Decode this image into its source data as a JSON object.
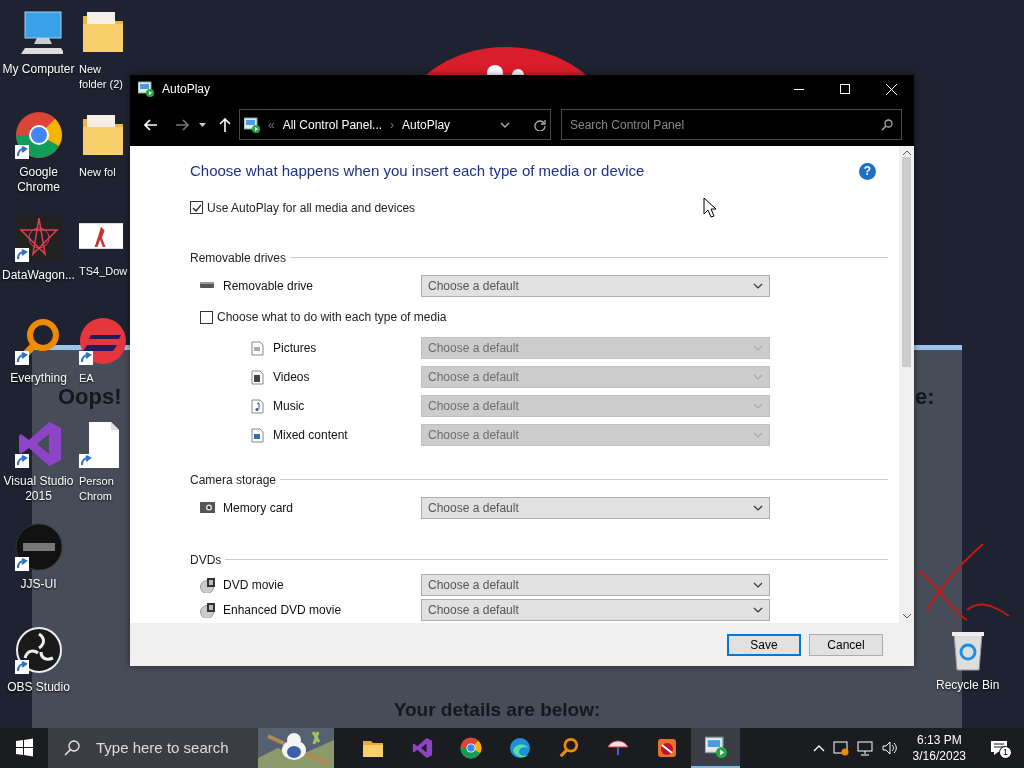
{
  "desktop_icons": [
    {
      "label": "My Computer",
      "kind": "computer",
      "shortcut": false
    },
    {
      "label": "Google Chrome",
      "kind": "chrome",
      "shortcut": true
    },
    {
      "label": "DataWagon...",
      "kind": "star",
      "shortcut": true
    },
    {
      "label": "Everything",
      "kind": "magnifier",
      "shortcut": true
    },
    {
      "label": "Visual Studio 2015",
      "kind": "ribbon",
      "shortcut": true
    },
    {
      "label": "JJS-UI",
      "kind": "darkcircle",
      "shortcut": true
    },
    {
      "label": "OBS Studio",
      "kind": "obs",
      "shortcut": true
    },
    {
      "label": "New folder (2)",
      "kind": "folder",
      "shortcut": false
    },
    {
      "label": "New fol",
      "kind": "folder",
      "shortcut": false
    },
    {
      "label": "TS4_Dow",
      "kind": "thumb",
      "shortcut": false
    },
    {
      "label": "EA",
      "kind": "redcircle",
      "shortcut": true
    },
    {
      "label": "Person Chrom",
      "kind": "document",
      "shortcut": true
    }
  ],
  "recycle_bin": {
    "label": "Recycle Bin"
  },
  "background_page": {
    "texts": [
      "Oops!",
      "e:",
      "Your details are below:"
    ]
  },
  "window": {
    "title": "AutoPlay",
    "address": {
      "overflow_mark": "«",
      "parts": [
        "All Control Panel...",
        "AutoPlay"
      ],
      "separator": "›"
    },
    "search": {
      "placeholder": "Search Control Panel"
    },
    "heading": "Choose what happens when you insert each type of media or device",
    "help": "?",
    "use_autoplay": {
      "label": "Use AutoPlay for all media and devices",
      "checked": true
    },
    "sections": [
      {
        "title": "Removable drives",
        "rows": [
          {
            "kind": "device",
            "label": "Removable drive",
            "value": "Choose a default",
            "disabled": false
          },
          {
            "kind": "checkbox",
            "label": "Choose what to do with each type of media",
            "checked": false
          },
          {
            "kind": "media",
            "label": "Pictures",
            "value": "Choose a default",
            "disabled": true
          },
          {
            "kind": "media",
            "label": "Videos",
            "value": "Choose a default",
            "disabled": true
          },
          {
            "kind": "media",
            "label": "Music",
            "value": "Choose a default",
            "disabled": true
          },
          {
            "kind": "media",
            "label": "Mixed content",
            "value": "Choose a default",
            "disabled": true
          }
        ]
      },
      {
        "title": "Camera storage",
        "rows": [
          {
            "kind": "device",
            "label": "Memory card",
            "value": "Choose a default",
            "disabled": false
          }
        ]
      },
      {
        "title": "DVDs",
        "rows": [
          {
            "kind": "device",
            "label": "DVD movie",
            "value": "Choose a default",
            "disabled": false
          },
          {
            "kind": "device",
            "label": "Enhanced DVD movie",
            "value": "Choose a default",
            "disabled": false
          }
        ]
      }
    ],
    "buttons": [
      {
        "label": "Save",
        "default": true
      },
      {
        "label": "Cancel",
        "default": false
      }
    ]
  },
  "taskbar": {
    "search": {
      "placeholder": "Type here to search"
    },
    "apps": [
      {
        "kind": "folder",
        "active": false
      },
      {
        "kind": "ribbon",
        "active": false
      },
      {
        "kind": "chrome",
        "active": false
      },
      {
        "kind": "edge",
        "active": false
      },
      {
        "kind": "magnifier",
        "active": false
      },
      {
        "kind": "umbrella",
        "active": false
      },
      {
        "kind": "candy",
        "active": false
      },
      {
        "kind": "panel",
        "active": true
      }
    ],
    "time": "6:13 PM",
    "date": "3/16/2023",
    "notifications": "1"
  }
}
